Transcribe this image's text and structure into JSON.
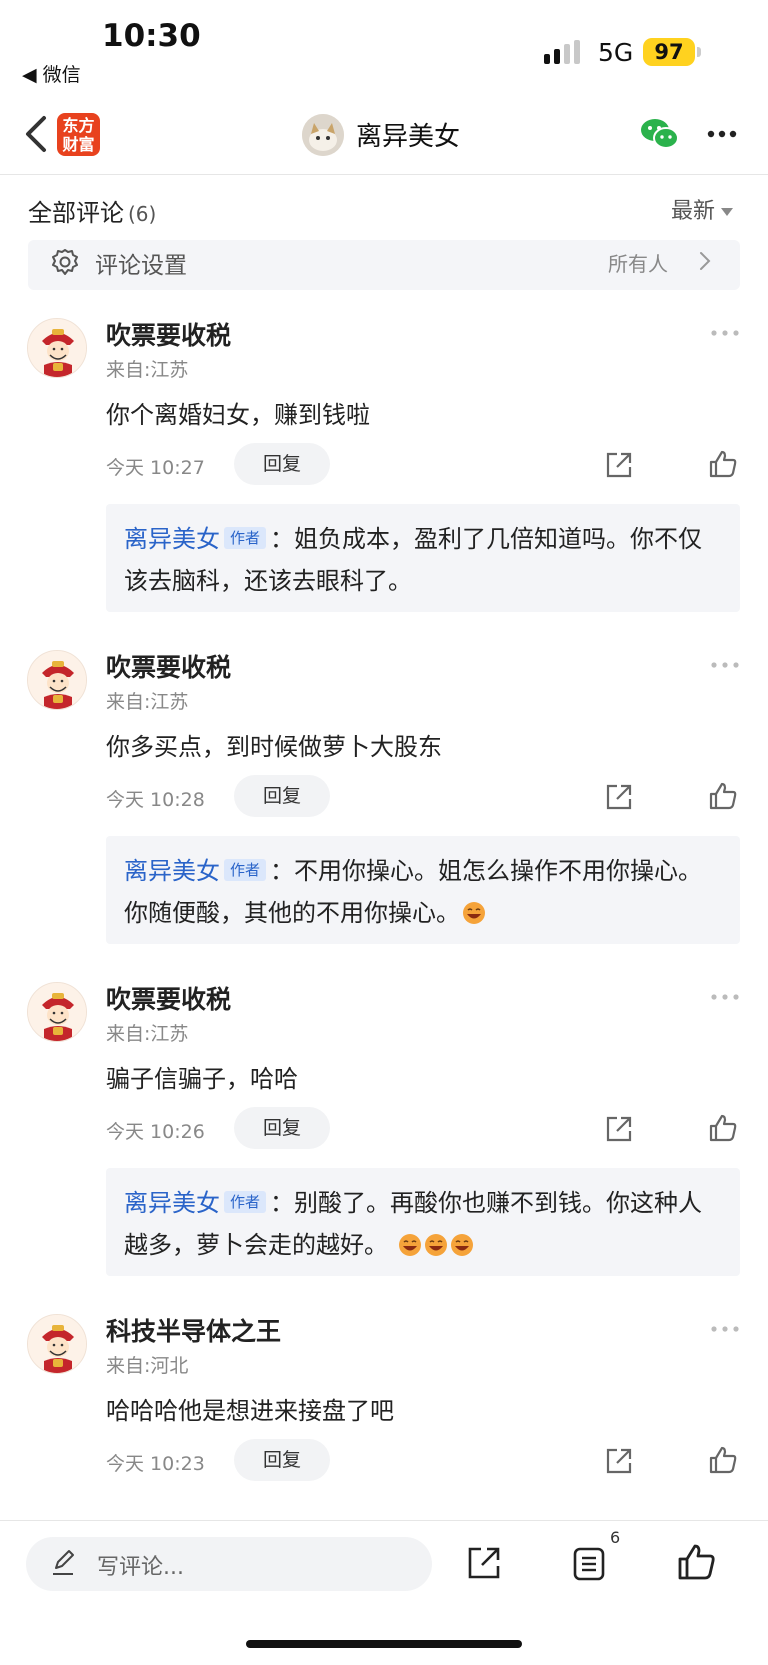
{
  "status": {
    "time": "10:30",
    "back_app": "◀ 微信",
    "network": "5G",
    "battery": "97"
  },
  "nav": {
    "app_logo_line1": "东方",
    "app_logo_line2": "财富",
    "author": "离异美女"
  },
  "header": {
    "title": "全部评论",
    "count": "(6)",
    "sort": "最新"
  },
  "settings": {
    "label": "评论设置",
    "value": "所有人"
  },
  "comments": [
    {
      "user": "吹票要收税",
      "location": "来自:江苏",
      "text": "你个离婚妇女，赚到钱啦",
      "time": "今天 10:27",
      "reply_label": "回复",
      "reply": {
        "name": "离异美女",
        "tag": "作者",
        "text": "：姐负成本，盈利了几倍知道吗。你不仅该去脑科，还该去眼科了。"
      }
    },
    {
      "user": "吹票要收税",
      "location": "来自:江苏",
      "text": "你多买点，到时候做萝卜大股东",
      "time": "今天 10:28",
      "reply_label": "回复",
      "reply": {
        "name": "离异美女",
        "tag": "作者",
        "text": "：不用你操心。姐怎么操作不用你操心。你随便酸，其他的不用你操心。"
      }
    },
    {
      "user": "吹票要收税",
      "location": "来自:江苏",
      "text": "骗子信骗子，哈哈",
      "time": "今天 10:26",
      "reply_label": "回复",
      "reply": {
        "name": "离异美女",
        "tag": "作者",
        "text": "：别酸了。再酸你也赚不到钱。你这种人越多，萝卜会走的越好。 "
      }
    },
    {
      "user": "科技半导体之王",
      "location": "来自:河北",
      "text": "哈哈哈他是想进来接盘了吧",
      "time": "今天 10:23",
      "reply_label": "回复"
    }
  ],
  "bottom": {
    "placeholder": "写评论...",
    "comment_count": "6"
  },
  "icons": [
    "chevron-left-icon",
    "wechat-icon",
    "more-icon",
    "gear-icon",
    "chevron-right-icon",
    "share-icon",
    "like-icon",
    "pencil-icon",
    "comments-icon",
    "grin-emoji-icon"
  ],
  "colors": {
    "accent_blue": "#2a64c9",
    "brand_orange": "#e8421e",
    "battery_yellow": "#ffd21f"
  }
}
